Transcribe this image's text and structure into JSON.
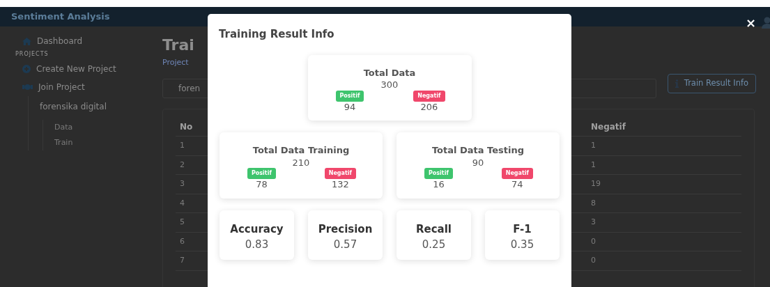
{
  "navbar": {
    "brand": "Sentiment Analysis"
  },
  "sidebar": {
    "items": [
      {
        "kind": "home",
        "label": "Dashboard"
      },
      {
        "kind": "heading",
        "label": "PROJECTS"
      },
      {
        "kind": "create",
        "label": "Create New Project"
      },
      {
        "kind": "join",
        "label": "Join Project"
      }
    ],
    "projects": [
      {
        "label": "forensika digital",
        "children": [
          {
            "label": "Data"
          },
          {
            "label": "Train"
          }
        ]
      }
    ]
  },
  "page": {
    "title": "Trai",
    "breadcrumb": "Project",
    "select_value": "foren",
    "info_button": "Train Result Info",
    "table": {
      "columns": [
        "No",
        "Negatif"
      ],
      "rows": [
        [
          "1",
          "1"
        ],
        [
          "2",
          "1"
        ],
        [
          "3",
          "19"
        ],
        [
          "4",
          "8"
        ],
        [
          "5",
          "3"
        ],
        [
          "6",
          "0"
        ],
        [
          "7",
          "0"
        ]
      ]
    }
  },
  "modal": {
    "title": "Training Result Info",
    "close": "×",
    "total": {
      "title": "Total Data",
      "value": "300",
      "classes": [
        {
          "kind": "positive",
          "label": "Positif",
          "value": "94"
        },
        {
          "kind": "negative",
          "label": "Negatif",
          "value": "206"
        }
      ]
    },
    "splits": [
      {
        "title": "Total Data Training",
        "value": "210",
        "classes": [
          {
            "kind": "positive",
            "label": "Positif",
            "value": "78"
          },
          {
            "kind": "negative",
            "label": "Negatif",
            "value": "132"
          }
        ]
      },
      {
        "title": "Total Data Testing",
        "value": "90",
        "classes": [
          {
            "kind": "positive",
            "label": "Positif",
            "value": "16"
          },
          {
            "kind": "negative",
            "label": "Negatif",
            "value": "74"
          }
        ]
      }
    ],
    "metrics": [
      {
        "label": "Accuracy",
        "value": "0.83"
      },
      {
        "label": "Precision",
        "value": "0.57"
      },
      {
        "label": "Recall",
        "value": "0.25"
      },
      {
        "label": "F-1",
        "value": "0.35"
      }
    ]
  }
}
